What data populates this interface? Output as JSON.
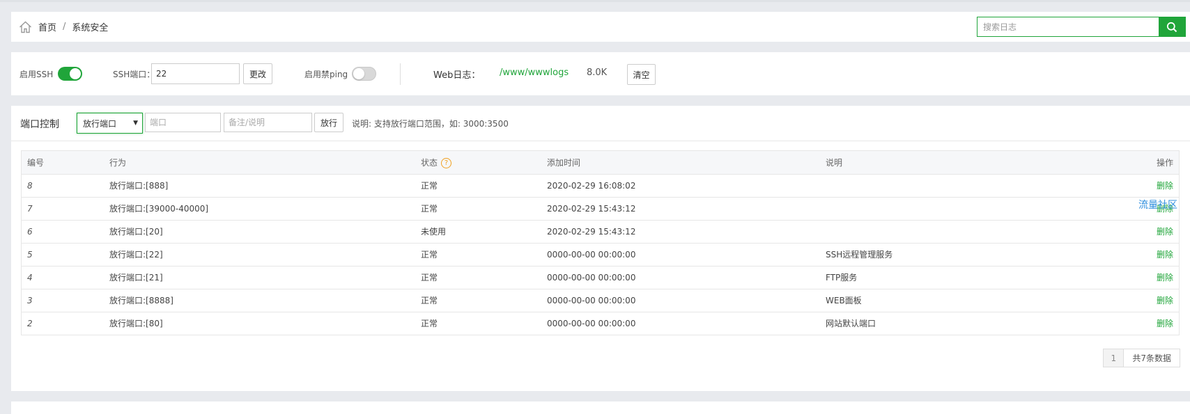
{
  "breadcrumb": {
    "home": "首页",
    "separator": "/",
    "current": "系统安全"
  },
  "search": {
    "placeholder": "搜索日志"
  },
  "settings": {
    "ssh_label": "启用SSH",
    "ssh_enabled": true,
    "ssh_port_label": "SSH端口：",
    "ssh_port_value": "22",
    "change_button": "更改",
    "ping_label": "启用禁ping",
    "ping_enabled": false,
    "web_log_label": "Web日志：",
    "web_log_path": "/www/wwwlogs",
    "web_log_size": "8.0K",
    "clear_button": "清空"
  },
  "port_control": {
    "title": "端口控制",
    "action_select": "放行端口",
    "port_placeholder": "端口",
    "remark_placeholder": "备注/说明",
    "allow_button": "放行",
    "hint": "说明: 支持放行端口范围，如: 3000:3500"
  },
  "table": {
    "headers": {
      "id": "编号",
      "action": "行为",
      "status": "状态",
      "time": "添加时间",
      "desc": "说明",
      "op": "操作"
    },
    "rows": [
      {
        "id": "8",
        "action": "放行端口:[888]",
        "status": "正常",
        "time": "2020-02-29 16:08:02",
        "desc": "",
        "op": "删除"
      },
      {
        "id": "7",
        "action": "放行端口:[39000-40000]",
        "status": "正常",
        "time": "2020-02-29 15:43:12",
        "desc": "",
        "op": "删除"
      },
      {
        "id": "6",
        "action": "放行端口:[20]",
        "status": "未使用",
        "time": "2020-02-29 15:43:12",
        "desc": "",
        "op": "删除"
      },
      {
        "id": "5",
        "action": "放行端口:[22]",
        "status": "正常",
        "time": "0000-00-00 00:00:00",
        "desc": "SSH远程管理服务",
        "op": "删除"
      },
      {
        "id": "4",
        "action": "放行端口:[21]",
        "status": "正常",
        "time": "0000-00-00 00:00:00",
        "desc": "FTP服务",
        "op": "删除"
      },
      {
        "id": "3",
        "action": "放行端口:[8888]",
        "status": "正常",
        "time": "0000-00-00 00:00:00",
        "desc": "WEB面板",
        "op": "删除"
      },
      {
        "id": "2",
        "action": "放行端口:[80]",
        "status": "正常",
        "time": "0000-00-00 00:00:00",
        "desc": "网站默认端口",
        "op": "删除"
      }
    ]
  },
  "pager": {
    "current_page": "1",
    "total": "共7条数据"
  },
  "float_link": "流量社区",
  "colors": {
    "accent": "#20a53a",
    "link": "#2f8fde",
    "warn": "#f0a020"
  }
}
